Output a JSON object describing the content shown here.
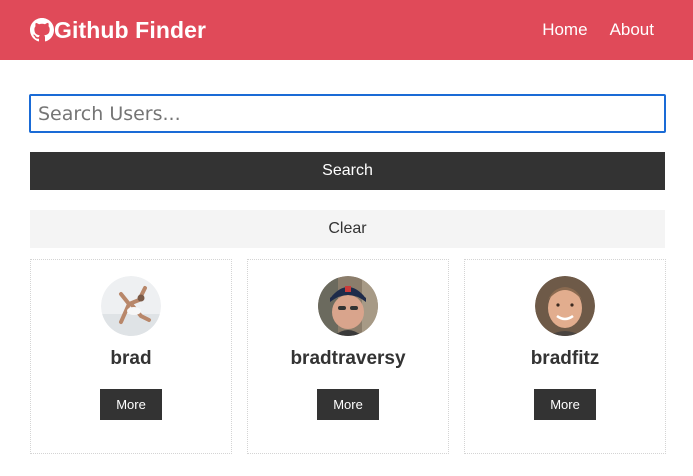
{
  "navbar": {
    "brand_icon": "github-icon",
    "brand_title": "Github Finder",
    "links": [
      {
        "label": "Home"
      },
      {
        "label": "About"
      }
    ],
    "color": "#e04a59"
  },
  "search": {
    "placeholder": "Search Users...",
    "value": "",
    "submit_label": "Search",
    "clear_label": "Clear"
  },
  "users": [
    {
      "login": "brad",
      "more_label": "More",
      "avatar": "user-avatar-photo"
    },
    {
      "login": "bradtraversy",
      "more_label": "More",
      "avatar": "user-avatar-photo"
    },
    {
      "login": "bradfitz",
      "more_label": "More",
      "avatar": "user-avatar-photo"
    }
  ]
}
